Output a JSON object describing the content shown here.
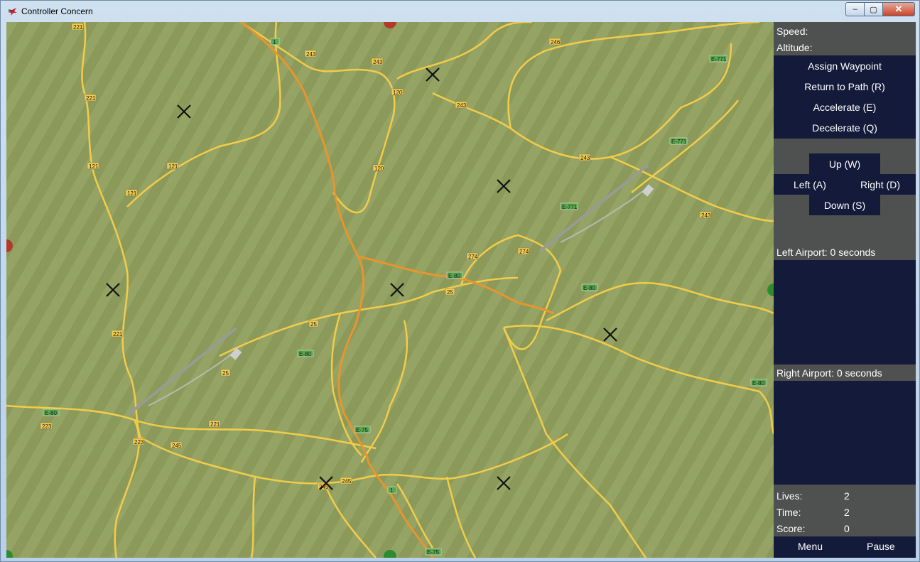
{
  "window": {
    "title": "Controller Concern",
    "minimize": "–",
    "maximize": "▢",
    "close": "✕"
  },
  "panel": {
    "speed_label": "Speed:",
    "altitude_label": "Altitude:",
    "commands": {
      "assign_waypoint": "Assign Waypoint",
      "return_to_path": "Return to Path (R)",
      "accelerate": "Accelerate (E)",
      "decelerate": "Decelerate (Q)"
    },
    "directions": {
      "up": "Up (W)",
      "left": "Left (A)",
      "right": "Right (D)",
      "down": "Down (S)"
    },
    "left_airport": "Left Airport: 0 seconds",
    "right_airport": "Right Airport: 0 seconds",
    "stats": {
      "lives_label": "Lives:",
      "lives_value": "2",
      "time_label": "Time:",
      "time_value": "2",
      "score_label": "Score:",
      "score_value": "0"
    },
    "menu": "Menu",
    "pause": "Pause"
  },
  "map": {
    "waypoint_icon": "x-mark-icon",
    "road_labels": [
      "221",
      "221",
      "221",
      "121",
      "121",
      "121",
      "243",
      "243",
      "243",
      "243",
      "120",
      "120",
      "246",
      "E-771",
      "E-771",
      "E-771",
      "1",
      "1",
      "274",
      "274",
      "E-80",
      "E-80",
      "E-80",
      "E-80",
      "E-80",
      "25",
      "25",
      "25",
      "E-75",
      "E-75",
      "223",
      "223",
      "245",
      "245",
      "245",
      "221",
      "243"
    ],
    "colors": {
      "terrain": "#8f9f5d",
      "road": "#f2cc4a",
      "highway": "#e8952e",
      "entry_red": "#b23a2a",
      "entry_green": "#2e8b2e"
    }
  }
}
